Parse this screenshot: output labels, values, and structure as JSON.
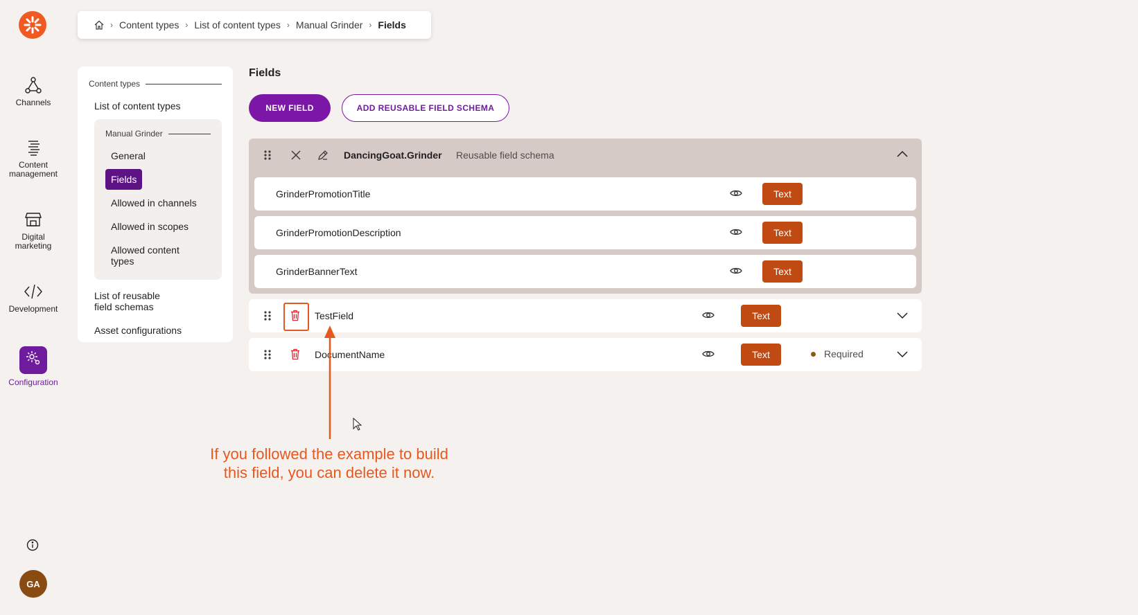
{
  "rail": {
    "items": [
      {
        "label": "Channels",
        "icon": "channels-icon"
      },
      {
        "label": "Content\nmanagement",
        "icon": "content-management-icon"
      },
      {
        "label": "Digital\nmarketing",
        "icon": "store-icon"
      },
      {
        "label": "Development",
        "icon": "code-icon"
      },
      {
        "label": "Configuration",
        "icon": "gear-icon"
      }
    ],
    "avatar": "GA"
  },
  "breadcrumb": {
    "items": [
      "Content types",
      "List of content types",
      "Manual Grinder"
    ],
    "current": "Fields"
  },
  "sidenav": {
    "section": "Content types",
    "list_link": "List of content types",
    "sub_section": "Manual Grinder",
    "sub_items": [
      "General",
      "Fields",
      "Allowed in channels",
      "Allowed in scopes",
      "Allowed content types"
    ],
    "reusable_link": "List of reusable field schemas",
    "asset_link": "Asset configurations"
  },
  "main": {
    "title": "Fields",
    "new_field": "NEW FIELD",
    "add_reusable": "ADD REUSABLE FIELD SCHEMA",
    "schema": {
      "name": "DancingGoat.Grinder",
      "subtitle": "Reusable field schema",
      "fields": [
        {
          "name": "GrinderPromotionTitle",
          "type": "Text"
        },
        {
          "name": "GrinderPromotionDescription",
          "type": "Text"
        },
        {
          "name": "GrinderBannerText",
          "type": "Text"
        }
      ]
    },
    "fields": [
      {
        "name": "TestField",
        "type": "Text",
        "required": ""
      },
      {
        "name": "DocumentName",
        "type": "Text",
        "required": "Required"
      }
    ]
  },
  "annotation": "If you followed the example to build this field, you can delete it now.",
  "colors": {
    "accent": "#7b16a6",
    "tag": "#c14a12",
    "annotation": "#e8571d",
    "logo": "#f05a22"
  }
}
